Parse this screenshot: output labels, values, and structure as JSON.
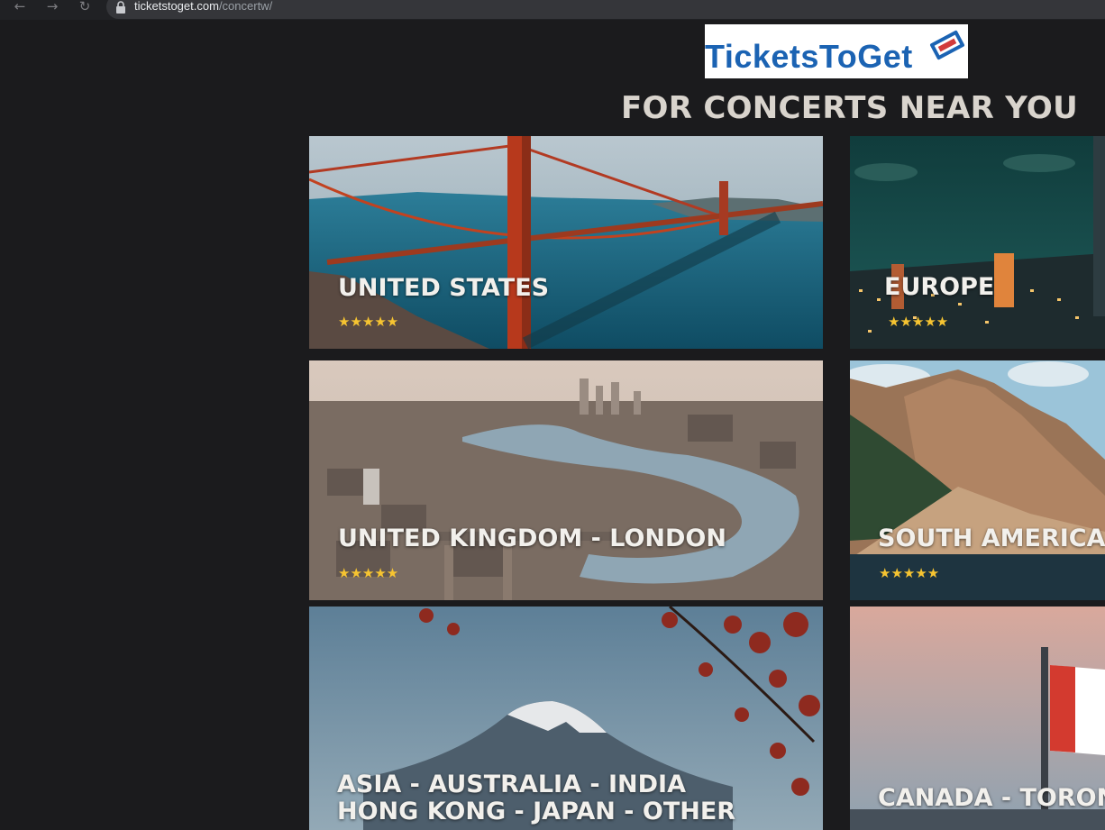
{
  "browser": {
    "url_host": "ticketstoget.com",
    "url_path": "/concertw/",
    "back_icon": "←",
    "forward_icon": "→",
    "reload_icon": "↻"
  },
  "logo": {
    "text": "TicketsToGet"
  },
  "heading": "FOR CONCERTS NEAR YOU",
  "cards": [
    {
      "title": "UNITED STATES",
      "stars": "★★★★★"
    },
    {
      "title": "EUROPE",
      "stars": "★★★★★"
    },
    {
      "title": "UNITED KINGDOM - LONDON",
      "stars": "★★★★★"
    },
    {
      "title": "SOUTH AMERICA",
      "stars": "★★★★★"
    },
    {
      "title_line1": "ASIA  -  AUSTRALIA  -  INDIA",
      "title_line2": "HONG KONG - JAPAN - OTHER"
    },
    {
      "title": "CANADA  - TORON"
    }
  ],
  "colors": {
    "page_bg": "#1b1b1d",
    "heading": "#d9d4cd",
    "stars": "#f6c431",
    "logo_blue": "#1b63b3"
  }
}
